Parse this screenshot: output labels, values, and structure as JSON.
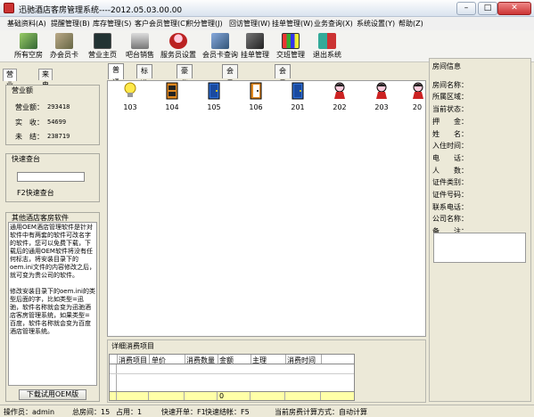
{
  "window": {
    "title": "迅驰酒店客房管理系统----2012.05.03.00.00"
  },
  "menu": [
    "基础资料(A)",
    "提醒管理(B)",
    "库存管理(S)",
    "客户会员管理(C)",
    "积分管理(J)",
    "回访管理(W)",
    "挂单管理(W)",
    "业务查询(X)",
    "系统设置(Y)",
    "帮助(Z)"
  ],
  "toolbar": [
    {
      "label": "所有空房",
      "icon": "book-icon"
    },
    {
      "label": "办会员卡",
      "icon": "member-card-icon"
    },
    {
      "label": "营业主页",
      "icon": "chart-icon"
    },
    {
      "label": "吧台销售",
      "icon": "bar-sales-icon"
    },
    {
      "label": "服务员设置",
      "icon": "waiter-icon"
    },
    {
      "label": "会员卡查询",
      "icon": "card-search-icon"
    },
    {
      "label": "挂单管理",
      "icon": "hang-order-icon"
    },
    {
      "label": "交班管理",
      "icon": "shift-icon"
    },
    {
      "label": "退出系统",
      "icon": "exit-icon"
    }
  ],
  "left_tabs": [
    "营业信息",
    "来电记录"
  ],
  "revenue": {
    "title": "营业额",
    "rows": [
      {
        "label": "营业额：",
        "value": "293418"
      },
      {
        "label": "实　收：",
        "value": "54699"
      },
      {
        "label": "未　结：",
        "value": "238719"
      }
    ]
  },
  "quick": {
    "title": "快速查台",
    "hint": "F2快速查台"
  },
  "other": {
    "title": "其他酒店客房软件",
    "text": "通用OEM酒店管理软件是针对软件中有两套的软件可改名字的软件，您可以免费下载，下载后的通用OEM软件将没有任何标志，将安装目录下的oem.ini文件的内容修改之后，就可变为贵公司的软件。\n\n修改安装目录下的oem.ini的类型后面的字，比如类型=迅驰，软件名称就会变为迅驰酒店客房管理系统，如果类型=百度，软件名称就会变为百度酒店管理系统。",
    "download_label": "下载试用OEM版"
  },
  "room_tabs": [
    "普通房",
    "标准单人间",
    "豪华双人人间",
    "会员标准单人间",
    "会员豪华双人间"
  ],
  "rooms": [
    {
      "number": "103",
      "icon": "lightbulb-icon",
      "status": "idle"
    },
    {
      "number": "104",
      "icon": "door-icon",
      "status": "occupied-orange"
    },
    {
      "number": "105",
      "icon": "door-icon",
      "status": "vacant-blue"
    },
    {
      "number": "106",
      "icon": "door-icon",
      "status": "open-orange"
    },
    {
      "number": "201",
      "icon": "door-icon",
      "status": "vacant-blue"
    },
    {
      "number": "202",
      "icon": "guest-icon",
      "status": "guest"
    },
    {
      "number": "203",
      "icon": "guest-icon",
      "status": "guest"
    },
    {
      "number": "20",
      "icon": "guest-icon",
      "status": "guest"
    }
  ],
  "detail": {
    "title": "详细消费项目",
    "columns": [
      "消费项目",
      "单价",
      "消费数量",
      "金额",
      "主理",
      "消费时间"
    ],
    "total_amount": "0"
  },
  "room_info": {
    "title": "房间信息",
    "labels": [
      "房间名称：",
      "所属区域：",
      "当前状态：",
      "押　　金：",
      "姓　　名：",
      "入住时间：",
      "电　　话：",
      "人　　数：",
      "证件类别：",
      "证件号码：",
      "联系电话：",
      "公司名称：",
      "备　　注："
    ]
  },
  "status": {
    "operator": "操作员：admin",
    "total_rooms": "总房间：15",
    "occupied": "占用：1",
    "shortcut_open": "快速开单：F1",
    "shortcut_checkout": "快速结帐：F5",
    "billing_mode": "当前房费计算方式：自动计算"
  }
}
